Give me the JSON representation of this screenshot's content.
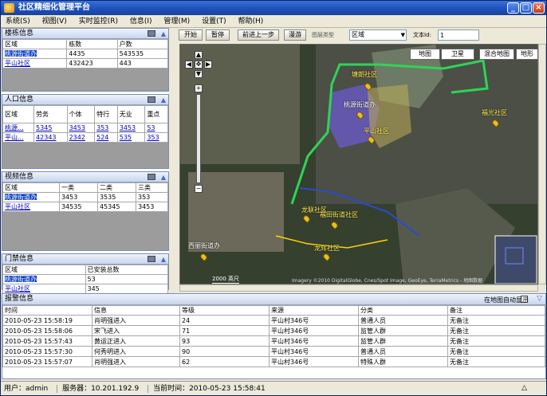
{
  "window": {
    "title": "社区精细化管理平台"
  },
  "menu": [
    "系统(S)",
    "视图(V)",
    "实时监控(R)",
    "信息(I)",
    "管理(M)",
    "设置(T)",
    "帮助(H)"
  ],
  "panels": {
    "building": {
      "title": "楼栋信息",
      "headers": [
        "区域",
        "栋数",
        "户数"
      ],
      "rows": [
        [
          "桃源街道办",
          "4435",
          "543535"
        ],
        [
          "平山社区",
          "432423",
          "443"
        ]
      ]
    },
    "population": {
      "title": "人口信息",
      "headers": [
        "区域",
        "劳务",
        "个体",
        "特行",
        "无业",
        "重点"
      ],
      "rows": [
        [
          "桃源...",
          "5345",
          "3453",
          "353",
          "3453",
          "53"
        ],
        [
          "平山...",
          "42343",
          "2342",
          "524",
          "535",
          "353"
        ]
      ]
    },
    "video": {
      "title": "视频信息",
      "headers": [
        "区域",
        "一类",
        "二类",
        "三类"
      ],
      "rows": [
        [
          "桃源街道办",
          "3453",
          "3535",
          "353"
        ],
        [
          "平山社区",
          "34535",
          "45345",
          "3453"
        ]
      ]
    },
    "door": {
      "title": "门禁信息",
      "headers": [
        "区域",
        "已安装总数"
      ],
      "rows": [
        [
          "桃源街道办",
          "53"
        ],
        [
          "平山社区",
          "345"
        ]
      ]
    }
  },
  "toolbar": {
    "start": "开始",
    "pause": "暂停",
    "prev": "前进上一步",
    "pan": "漫游",
    "layer_type_label": "图层类型",
    "layer_type_value": "区域",
    "text_id_label": "文本Id:",
    "text_id_value": "1"
  },
  "map": {
    "types": [
      "地图",
      "卫星",
      "混合地图",
      "地形"
    ],
    "labels": [
      "塘朗社区",
      "桃源街道办",
      "平山社区",
      "福光社区",
      "龙联社区",
      "福田街道社区",
      "西丽街道办",
      "龙辉社区"
    ],
    "scale": "2000 英尺",
    "copyright": "Imagery ©2010 DigitalGlobe, Cnes/Spot Image, GeoEye, TerraMetrics - 地图数据"
  },
  "alarm": {
    "title": "报警信息",
    "show_on_map": "在地图自动显示",
    "headers": [
      "时间",
      "信息",
      "等级",
      "来源",
      "分类",
      "备注"
    ],
    "rows": [
      [
        "2010-05-23 15:58:19",
        "肖明强进入",
        "24",
        "平山村346号",
        "普通人员",
        "无备注"
      ],
      [
        "2010-05-23 15:58:06",
        "宋飞进入",
        "71",
        "平山村346号",
        "监管人群",
        "无备注"
      ],
      [
        "2010-05-23 15:57:43",
        "黄运正进入",
        "93",
        "平山村346号",
        "监管人群",
        "无备注"
      ],
      [
        "2010-05-23 15:57:30",
        "何秀明进入",
        "90",
        "平山村346号",
        "普通人员",
        "无备注"
      ],
      [
        "2010-05-23 15:57:07",
        "肖明强进入",
        "62",
        "平山村346号",
        "特殊人群",
        "无备注"
      ]
    ]
  },
  "status": {
    "user": "用户：admin",
    "server": "服务器：10.201.192.9",
    "time": "当前时间：2010-05-23 15:58:41"
  },
  "colors": {
    "title_blue": "#1c4fb8",
    "boundary_green": "#2fd35a",
    "region_purple": "#6a5acd"
  }
}
